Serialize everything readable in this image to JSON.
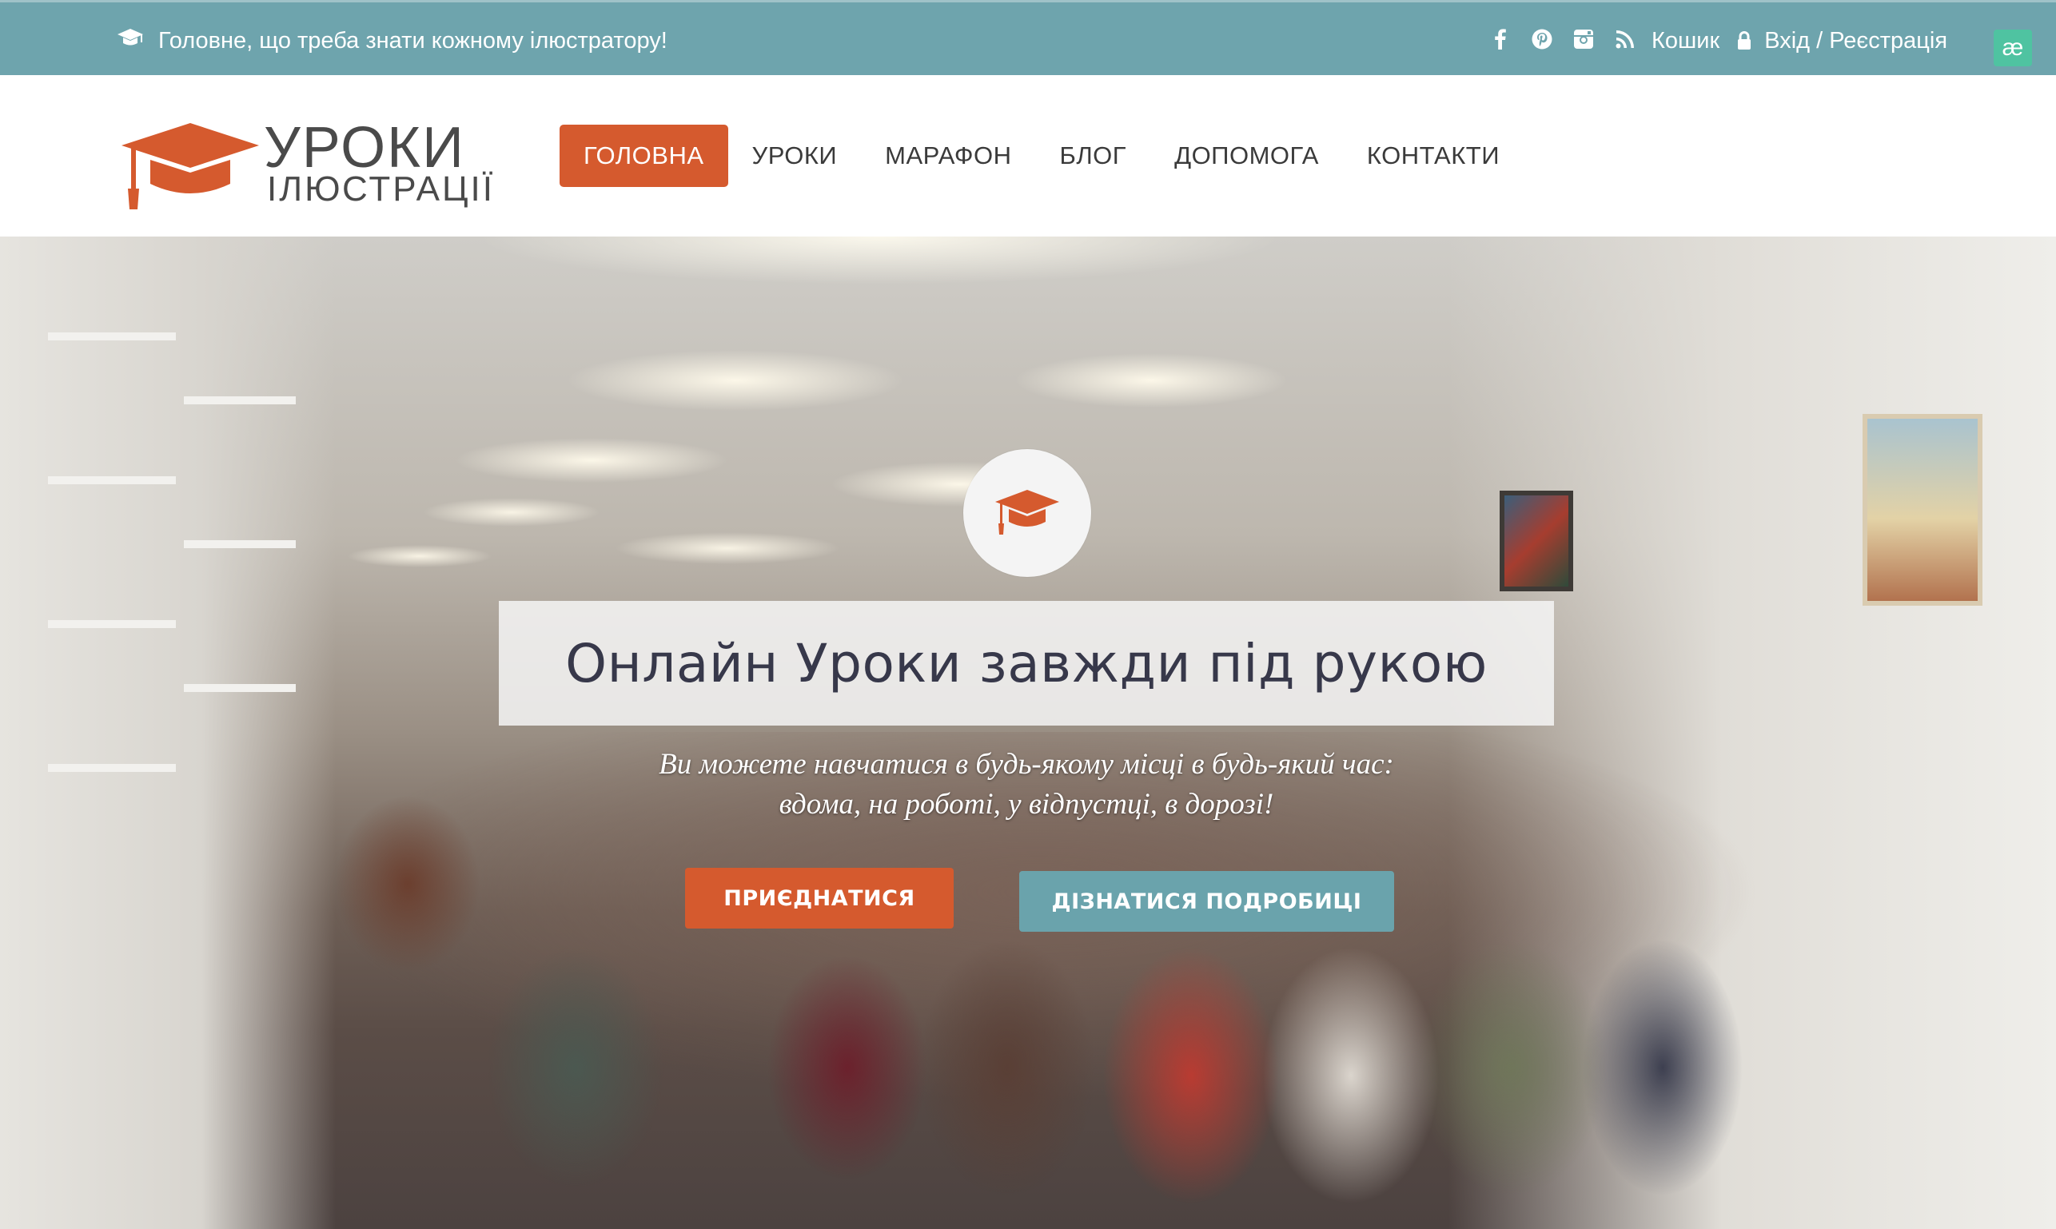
{
  "topbar": {
    "tagline": "Головне, що треба знати кожному ілюстратору!",
    "tagline_icon": "graduation-cap-icon",
    "social_icons": [
      "facebook-icon",
      "pinterest-icon",
      "instagram-icon",
      "rss-icon"
    ],
    "cart_label": "Кошик",
    "login_label": "Вхід / Реєстрація",
    "badge_text": "æ"
  },
  "header": {
    "logo_line1": "УРОКИ",
    "logo_line2": "ІЛЮСТРАЦІЇ",
    "nav": [
      {
        "label": "ГОЛОВНА",
        "active": true
      },
      {
        "label": "УРОКИ",
        "active": false
      },
      {
        "label": "МАРАФОН",
        "active": false
      },
      {
        "label": "БЛОГ",
        "active": false
      },
      {
        "label": "ДОПОМОГА",
        "active": false
      },
      {
        "label": "КОНТАКТИ",
        "active": false
      }
    ]
  },
  "hero": {
    "icon": "graduation-cap-icon",
    "headline": "Онлайн Уроки завжди під рукою",
    "subtitle_line1": "Ви можете навчатися в будь-якому місці в будь-який час:",
    "subtitle_line2": "вдома, на роботі, у відпустці, в дорозі!",
    "join_button": "ПРИЄДНАТИСЯ",
    "more_button": "ДІЗНАТИСЯ ПОДРОБИЦІ"
  },
  "colors": {
    "topbar_bg": "#6ea4ad",
    "accent_orange": "#d55a2e",
    "accent_teal": "#6aa3ac",
    "text_dark": "#37384a"
  }
}
